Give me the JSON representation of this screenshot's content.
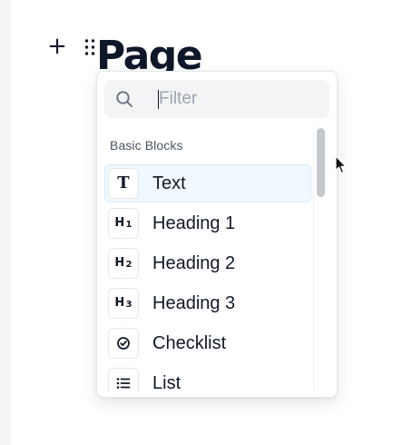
{
  "editor": {
    "add_block_glyph": "+",
    "page_title": "Page"
  },
  "menu": {
    "filter": {
      "placeholder": "Filter",
      "value": "",
      "icon": "search-icon"
    },
    "section_label": "Basic Blocks",
    "selected_index": 0,
    "items": [
      {
        "label": "Text",
        "icon": "text-icon"
      },
      {
        "label": "Heading 1",
        "icon": "heading-1-icon"
      },
      {
        "label": "Heading 2",
        "icon": "heading-2-icon"
      },
      {
        "label": "Heading 3",
        "icon": "heading-3-icon"
      },
      {
        "label": "Checklist",
        "icon": "checklist-icon"
      },
      {
        "label": "List",
        "icon": "list-icon"
      }
    ]
  },
  "colors": {
    "title": "#0f172a",
    "selected_background": "#f0f9ff",
    "scrollbar_thumb": "#c4c7cc",
    "text": "#111827",
    "muted": "#4b5563"
  }
}
